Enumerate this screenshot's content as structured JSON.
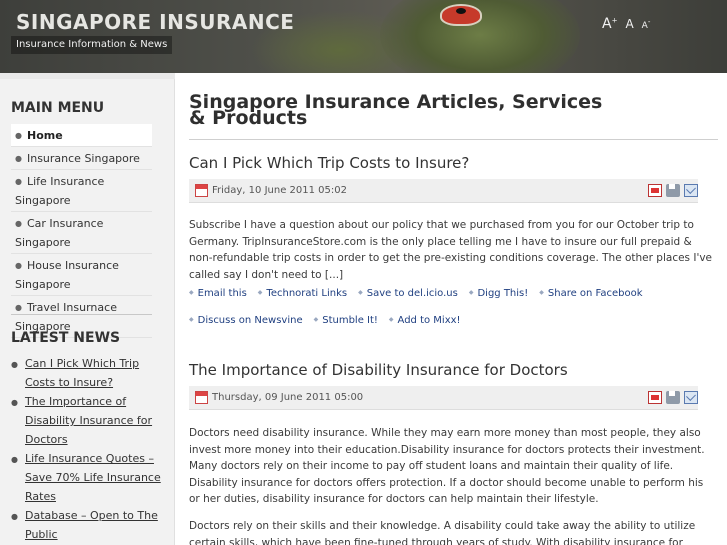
{
  "header": {
    "site_title": "SINGAPORE INSURANCE",
    "tagline": "Insurance Information & News",
    "font_tools": {
      "increase": "A",
      "increase_sup": "+",
      "reset": "A",
      "decrease": "A",
      "decrease_sup": "-"
    }
  },
  "sidebar": {
    "main_menu_heading": "MAIN MENU",
    "menu_items": [
      {
        "label": "Home"
      },
      {
        "label": "Insurance Singapore"
      },
      {
        "label": "Life Insurance Singapore"
      },
      {
        "label": "Car Insurance Singapore"
      },
      {
        "label": "House Insurance Singapore"
      },
      {
        "label": "Travel Insurnace Singapore"
      }
    ],
    "latest_news_heading": "LATEST NEWS",
    "news_items": [
      {
        "label": "Can I Pick Which Trip Costs to Insure?"
      },
      {
        "label": "The Importance of Disability Insurance for Doctors"
      },
      {
        "label": "Life Insurance Quotes – Save 70% Life Insurance Rates"
      },
      {
        "label": "Database – Open to The Public"
      }
    ]
  },
  "main": {
    "page_title": "Singapore Insurance Articles, Services & Products",
    "articles": [
      {
        "title": "Can I Pick Which Trip Costs to Insure?",
        "date": "Friday, 10 June 2011 05:02",
        "body": "Subscribe I have a question about our policy that we purchased from you for our October trip to Germany. TripInsuranceStore.com is the only place telling me I have to insure our full prepaid & non-refundable trip costs in order to get the pre-existing conditions coverage. The other places I've called say I don't need to [...]",
        "share_row1": [
          "Email this",
          "Technorati Links",
          "Save to del.icio.us",
          "Digg This!",
          "Share on Facebook"
        ],
        "share_row2": [
          "Discuss on Newsvine",
          "Stumble It!",
          "Add to Mixx!"
        ]
      },
      {
        "title": "The Importance of Disability Insurance for Doctors",
        "date": "Thursday, 09 June 2011 05:00",
        "body": "Doctors need disability insurance. While they may earn more money than most people, they also invest more money into their education.Disability insurance for doctors protects their investment. Many doctors rely on their income to pay off student loans and maintain their quality of life. Disability insurance for doctors offers protection. If a doctor should become unable to perform his or her duties, disability insurance for doctors can help maintain their lifestyle.",
        "body2": "Doctors rely on their skills and their knowledge. A disability could take away the ability to utilize certain skills, which have been fine-tuned through years of study. With disability insurance for doctors, the"
      }
    ]
  },
  "colors": {
    "header_bg": "#3e3f3b",
    "sidebar_bg": "#f2f2f2",
    "link": "#1f3f80"
  },
  "icons": [
    "calendar-icon",
    "pdf-icon",
    "print-icon",
    "email-icon"
  ]
}
